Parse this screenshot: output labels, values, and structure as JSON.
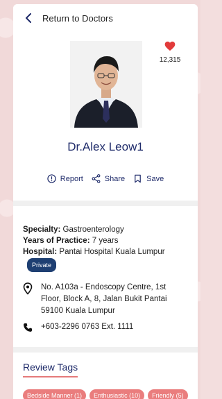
{
  "header": {
    "back_label": "Return to Doctors"
  },
  "doctor": {
    "name": "Dr.Alex Leow1",
    "likes": "12,315",
    "photo_alt": "doctor-portrait"
  },
  "actions": [
    {
      "label": "Report",
      "icon": "info-icon"
    },
    {
      "label": "Share",
      "icon": "share-icon"
    },
    {
      "label": "Save",
      "icon": "bookmark-icon"
    }
  ],
  "info": {
    "specialty_label": "Specialty:",
    "specialty": "Gastroenterology",
    "years_label": "Years of Practice:",
    "years": "7 years",
    "hospital_label": "Hospital:",
    "hospital": "Pantai Hospital Kuala Lumpur",
    "badge": "Private",
    "address": "No. A103a - Endoscopy Centre, 1st Floor, Block A, 8, Jalan Bukit Pantai 59100 Kuala Lumpur",
    "phone": "+603-2296 0763 Ext. 1111"
  },
  "reviews": {
    "title": "Review Tags",
    "tags": [
      "Bedside Manner (1)",
      "Enthusiastic (10)",
      "Friendly (5)"
    ]
  },
  "colors": {
    "accent": "#1f2b6a",
    "heart": "#e23b3b",
    "tag": "#ea7d7d",
    "badge": "#1e3f72"
  }
}
